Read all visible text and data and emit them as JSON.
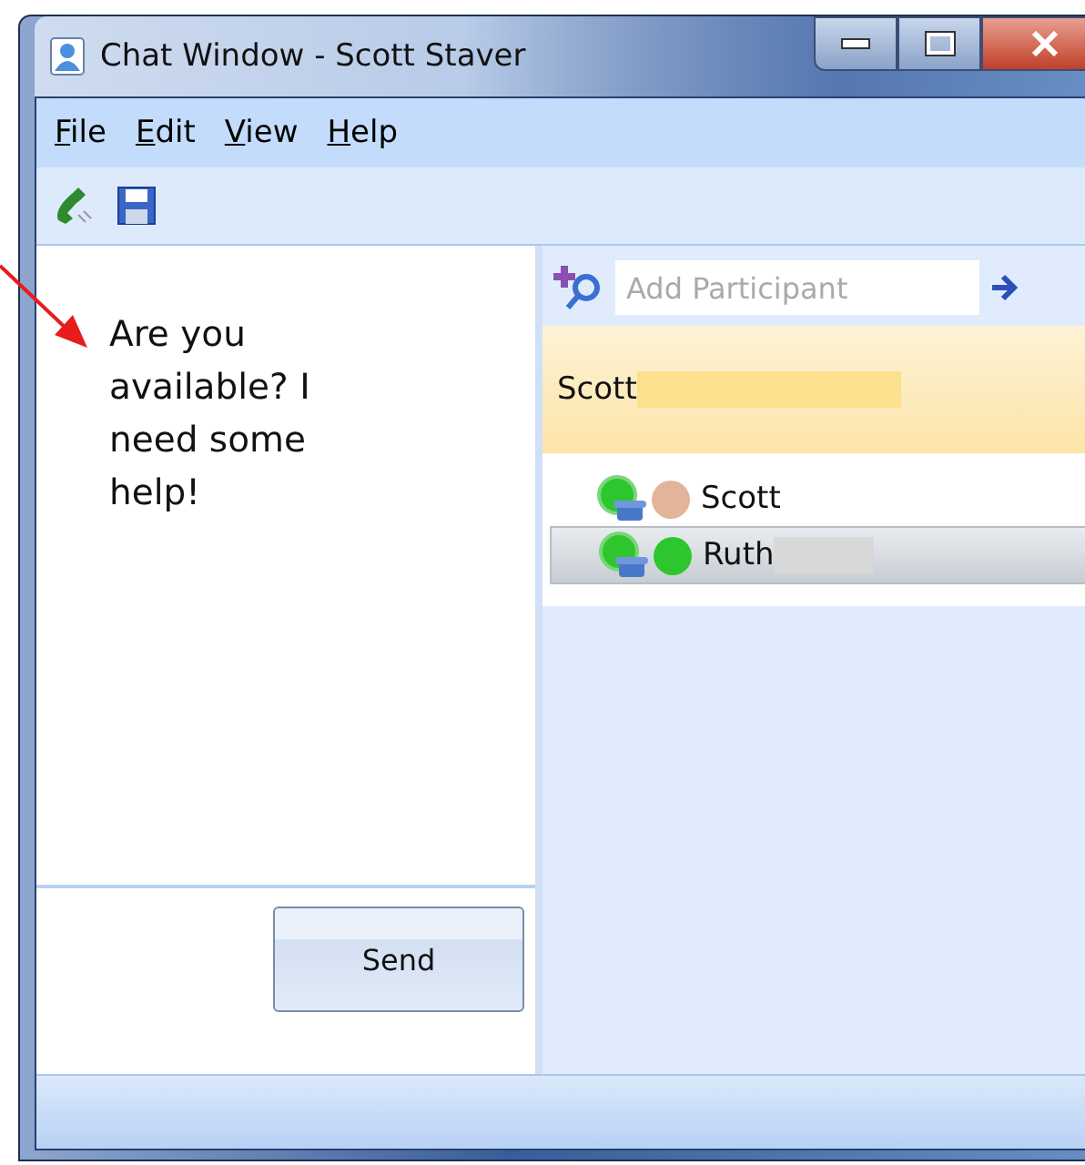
{
  "window": {
    "title": "Chat Window - Scott Staver"
  },
  "menu": [
    "File",
    "Edit",
    "View",
    "Help"
  ],
  "message": {
    "text": "Are you available? I need some help!"
  },
  "compose": {
    "send_label": "Send"
  },
  "participants_panel": {
    "search_placeholder": "Add Participant",
    "header": "Scott",
    "participants": [
      {
        "name": "Scott",
        "color": "#e2b49a",
        "selected": false
      },
      {
        "name": "Ruth",
        "color": "#2ec62e",
        "selected": true
      }
    ]
  }
}
